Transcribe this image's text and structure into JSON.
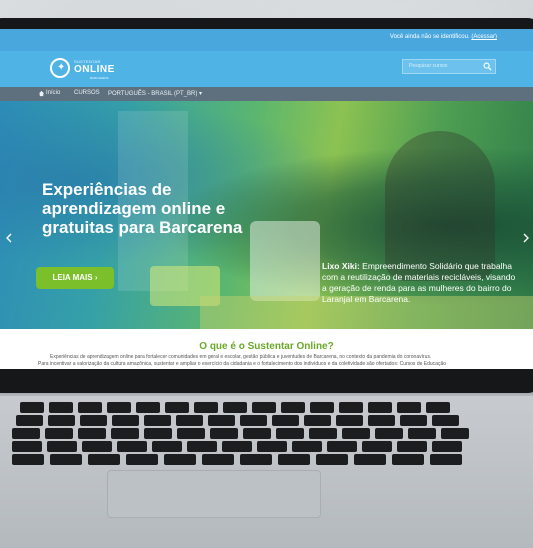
{
  "topbar": {
    "login_prefix": "Você ainda não se identificou.",
    "login_link": "(Acessar)"
  },
  "header": {
    "logo_small": "SUSTENTAR",
    "logo_big": "ONLINE",
    "logo_tiny": "BARCARENA",
    "search_placeholder": "Pesquisar cursos"
  },
  "nav": {
    "home": "Início",
    "courses": "CURSOS",
    "language": "PORTUGUÊS - BRASIL (PT_BR)"
  },
  "hero": {
    "title": "Experiências de aprendizagem online e gratuitas para Barcarena",
    "button": "LEIA MAIS",
    "caption_bold": "Lixo Xiki:",
    "caption_text": "Empreendimento Solidário que trabalha com a reutilização de materiais recicláveis, visando a geração de renda para as mulheres do bairro do Laranjal em Barcarena."
  },
  "about": {
    "title": "O que é o Sustentar Online?",
    "text1": "Experiências de aprendizagem online para fortalecer comunidades em geral e escolar, gestão pública e juventudes de Barcarena, no contexto da pandemia do coronavírus.",
    "text2": "Para incentivar a valorização da cultura amazônica, sustentar e ampliar o exercício da cidadania e o fortalecimento dos indivíduos e da coletividade são ofertados: Cursos de Educação"
  },
  "colors": {
    "topbar": "#4aa7de",
    "header": "#4fb3e6",
    "nav": "#5e6f7d",
    "accent_green": "#7bbf2a",
    "title_green": "#6aa827"
  }
}
